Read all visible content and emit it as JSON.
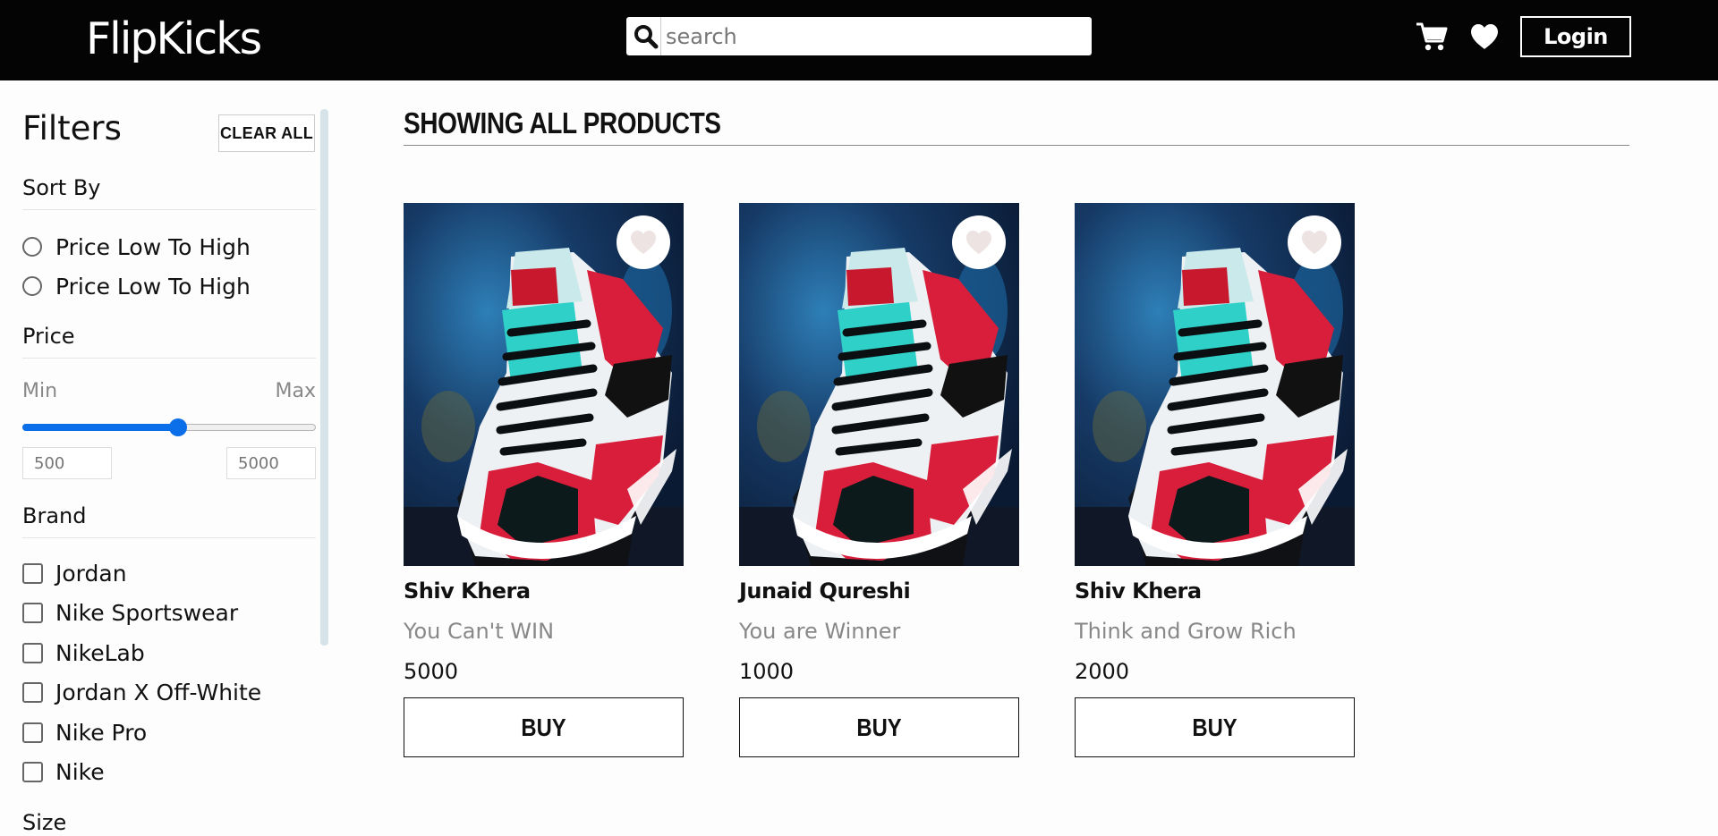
{
  "header": {
    "logo": "FlipKicks",
    "search_placeholder": "search",
    "login_label": "Login"
  },
  "sidebar": {
    "title": "Filters",
    "clear_all_label": "CLEAR ALL",
    "sort_title": "Sort By",
    "sort_options": [
      "Price Low To High",
      "Price Low To High"
    ],
    "price_title": "Price",
    "min_label": "Min",
    "max_label": "Max",
    "price_slider_fraction": 0.53,
    "min_placeholder": "500",
    "max_placeholder": "5000",
    "brand_title": "Brand",
    "brands": [
      "Jordan",
      "Nike Sportswear",
      "NikeLab",
      "Jordan X Off-White",
      "Nike Pro",
      "Nike"
    ],
    "size_title": "Size"
  },
  "main": {
    "title": "SHOWING ALL PRODUCTS",
    "products": [
      {
        "name": "Shiv Khera",
        "description": "You Can't WIN",
        "price": "5000",
        "buy_label": "BUY"
      },
      {
        "name": "Junaid Qureshi",
        "description": "You are Winner",
        "price": "1000",
        "buy_label": "BUY"
      },
      {
        "name": "Shiv Khera",
        "description": "Think and Grow Rich",
        "price": "2000",
        "buy_label": "BUY"
      }
    ]
  },
  "colors": {
    "header_bg": "#040404",
    "accent": "#0a6fe8",
    "shoe_red": "#d81e3a",
    "shoe_teal": "#2fd0c8"
  },
  "icons": {
    "search": "search-icon",
    "cart": "cart-icon",
    "wishlist": "heart-icon"
  }
}
